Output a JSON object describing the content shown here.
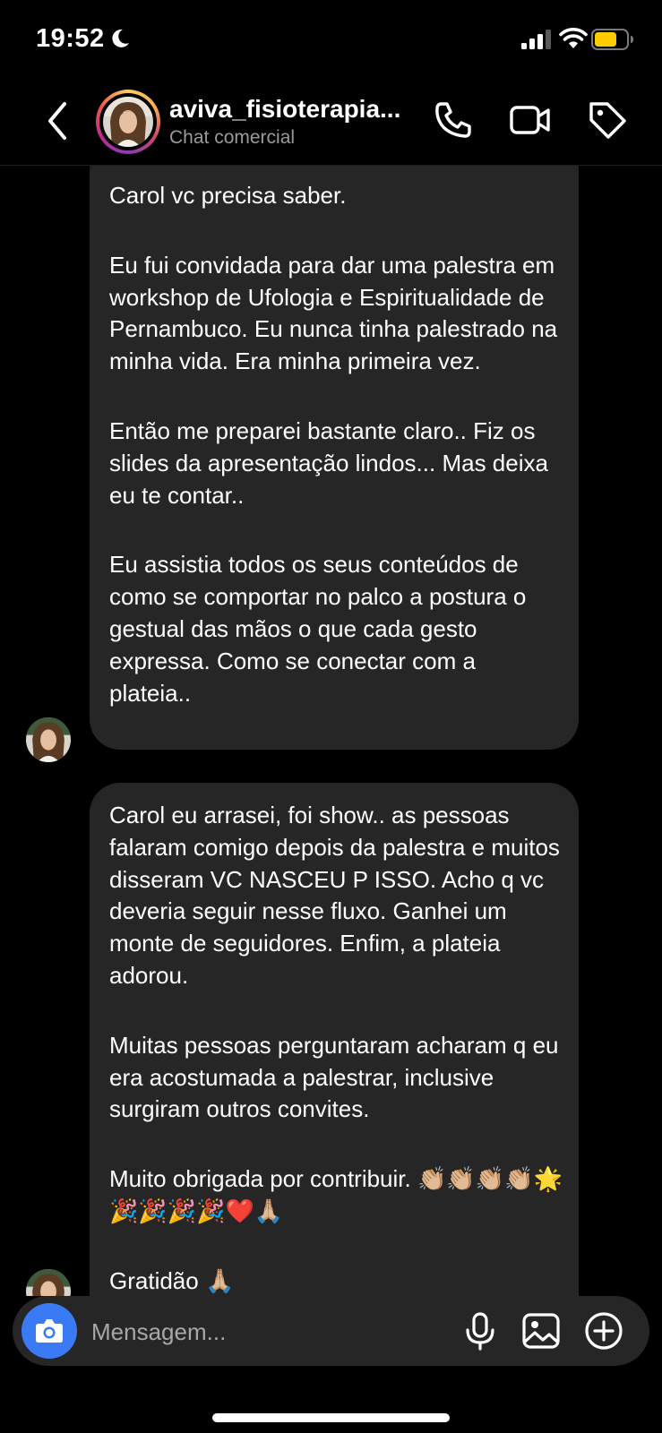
{
  "status_bar": {
    "time": "19:52",
    "icons": [
      "moon-icon",
      "signal-icon",
      "wifi-icon",
      "battery-icon"
    ],
    "battery_color": "#ffcc00"
  },
  "header": {
    "name": "aviva_fisioterapia...",
    "subtitle": "Chat comercial",
    "icons": [
      "back-chevron-icon",
      "phone-icon",
      "video-camera-icon",
      "tag-icon"
    ],
    "avatar_ring_colors": [
      "#fccc63",
      "#cd486b",
      "#8a3ab9"
    ]
  },
  "messages": [
    {
      "sender": "aviva_fisioterapia",
      "paragraphs": [
        "Carol vc precisa saber.",
        "Eu fui convidada para dar uma palestra em workshop de Ufologia e Espiritualidade de Pernambuco. Eu nunca tinha palestrado na minha vida. Era minha primeira vez.",
        "Então me preparei bastante claro.. Fiz os slides da apresentação lindos... Mas deixa eu te contar..",
        "Eu assistia todos os seus conteúdos de como se comportar no palco a postura o gestual das mãos o que cada gesto expressa. Como se conectar com a plateia.."
      ]
    },
    {
      "sender": "aviva_fisioterapia",
      "paragraphs": [
        "Carol eu arrasei, foi show.. as pessoas falaram comigo depois da palestra e muitos disseram VC NASCEU P ISSO. Acho q vc deveria seguir nesse fluxo. Ganhei um monte de seguidores. Enfim, a plateia adorou.",
        "Muitas pessoas perguntaram acharam q eu era acostumada a palestrar, inclusive surgiram outros convites.",
        "Muito obrigada por contribuir. 👏🏼👏🏼👏🏼👏🏼🌟🎉🎉🎉🎉❤️🙏🏼",
        "Gratidão 🙏🏼"
      ]
    }
  ],
  "composer": {
    "placeholder": "Mensagem...",
    "icons": [
      "camera-icon",
      "microphone-icon",
      "image-icon",
      "plus-circle-icon"
    ],
    "camera_button_color": "#3a7bf5"
  }
}
